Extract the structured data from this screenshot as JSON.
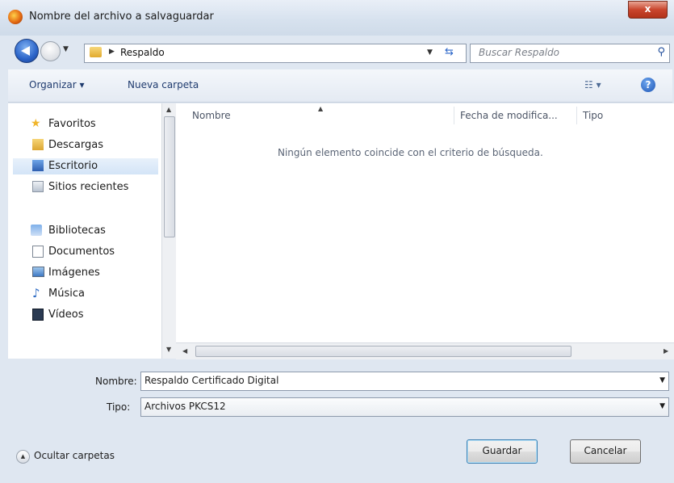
{
  "window": {
    "title": "Nombre del archivo a salvaguardar",
    "close_label": "x"
  },
  "address": {
    "path": "Respaldo",
    "search_placeholder": "Buscar Respaldo"
  },
  "toolbar": {
    "organize": "Organizar ▾",
    "new_folder": "Nueva carpeta"
  },
  "sidebar": {
    "favorites": "Favoritos",
    "fav_items": [
      "Descargas",
      "Escritorio",
      "Sitios recientes"
    ],
    "libraries": "Bibliotecas",
    "lib_items": [
      "Documentos",
      "Imágenes",
      "Música",
      "Vídeos"
    ],
    "selected": "Escritorio"
  },
  "columns": {
    "name": "Nombre",
    "modified": "Fecha de modifica...",
    "type": "Tipo"
  },
  "empty_message": "Ningún elemento coincide con el criterio de búsqueda.",
  "form": {
    "name_label": "Nombre:",
    "name_value": "Respaldo Certificado Digital",
    "type_label": "Tipo:",
    "type_value": "Archivos PKCS12"
  },
  "footer": {
    "hide_folders": "Ocultar carpetas",
    "save": "Guardar",
    "cancel": "Cancelar"
  },
  "icons": [
    "back-icon",
    "forward-icon",
    "folder-icon",
    "refresh-icon",
    "search-icon",
    "view-icon",
    "help-icon",
    "star-icon",
    "collapse-icon"
  ]
}
